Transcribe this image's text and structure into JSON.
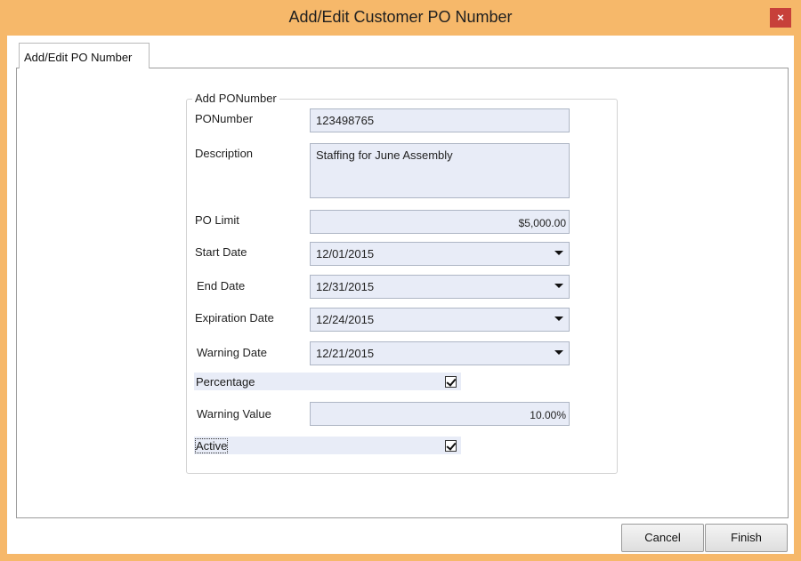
{
  "window": {
    "title": "Add/Edit Customer PO Number",
    "close_label": "×"
  },
  "tabs": [
    {
      "label": "Add/Edit PO Number"
    }
  ],
  "group": {
    "title": "Add PONumber"
  },
  "form": {
    "ponumber": {
      "label": "PONumber",
      "value": "123498765"
    },
    "description": {
      "label": "Description",
      "value": "Staffing for June Assembly"
    },
    "po_limit": {
      "label": "PO Limit",
      "value": "$5,000.00"
    },
    "start_date": {
      "label": "Start Date",
      "value": "12/01/2015"
    },
    "end_date": {
      "label": "End Date",
      "value": "12/31/2015"
    },
    "expiration_date": {
      "label": "Expiration Date",
      "value": "12/24/2015"
    },
    "warning_date": {
      "label": "Warning Date",
      "value": "12/21/2015"
    },
    "percentage": {
      "label": "Percentage",
      "checked": true
    },
    "warning_value": {
      "label": "Warning Value",
      "value": "10.00%"
    },
    "active": {
      "label": "Active",
      "checked": true
    }
  },
  "buttons": {
    "cancel": "Cancel",
    "finish": "Finish"
  },
  "colors": {
    "frame": "#f6b86a",
    "field_bg": "#e8ecf7",
    "close": "#c7403a"
  }
}
